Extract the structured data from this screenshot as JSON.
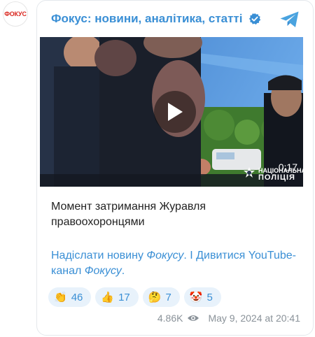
{
  "channel": {
    "logo_text": "ФОКУС",
    "name": "Фокус: новини, аналітика, статті"
  },
  "video": {
    "duration": "0:17",
    "watermark_line1": "НАЦІОНАЛЬНА",
    "watermark_line2": "ПОЛІЦІЯ"
  },
  "post": {
    "text": "Момент затримання Журавля правоохоронцями",
    "link1_a": "Надіслати новину ",
    "link1_b": "Фокусу",
    "separator": ". І ",
    "link2_a": "Дивитися YouTube-канал ",
    "link2_b": "Фокусу",
    "end": "."
  },
  "reactions": [
    {
      "emoji": "👏",
      "count": "46"
    },
    {
      "emoji": "👍",
      "count": "17"
    },
    {
      "emoji": "🤔",
      "count": "7"
    },
    {
      "emoji": "🤡",
      "count": "5"
    }
  ],
  "footer": {
    "views": "4.86K",
    "date": "May 9, 2024 at 20:41"
  },
  "colors": {
    "accent": "#3a8fd5",
    "logo_red": "#d9251d",
    "reaction_bg": "#e8f2fb"
  },
  "icons": [
    "verified-icon",
    "telegram-icon",
    "play-icon",
    "eye-icon",
    "police-emblem-icon"
  ]
}
